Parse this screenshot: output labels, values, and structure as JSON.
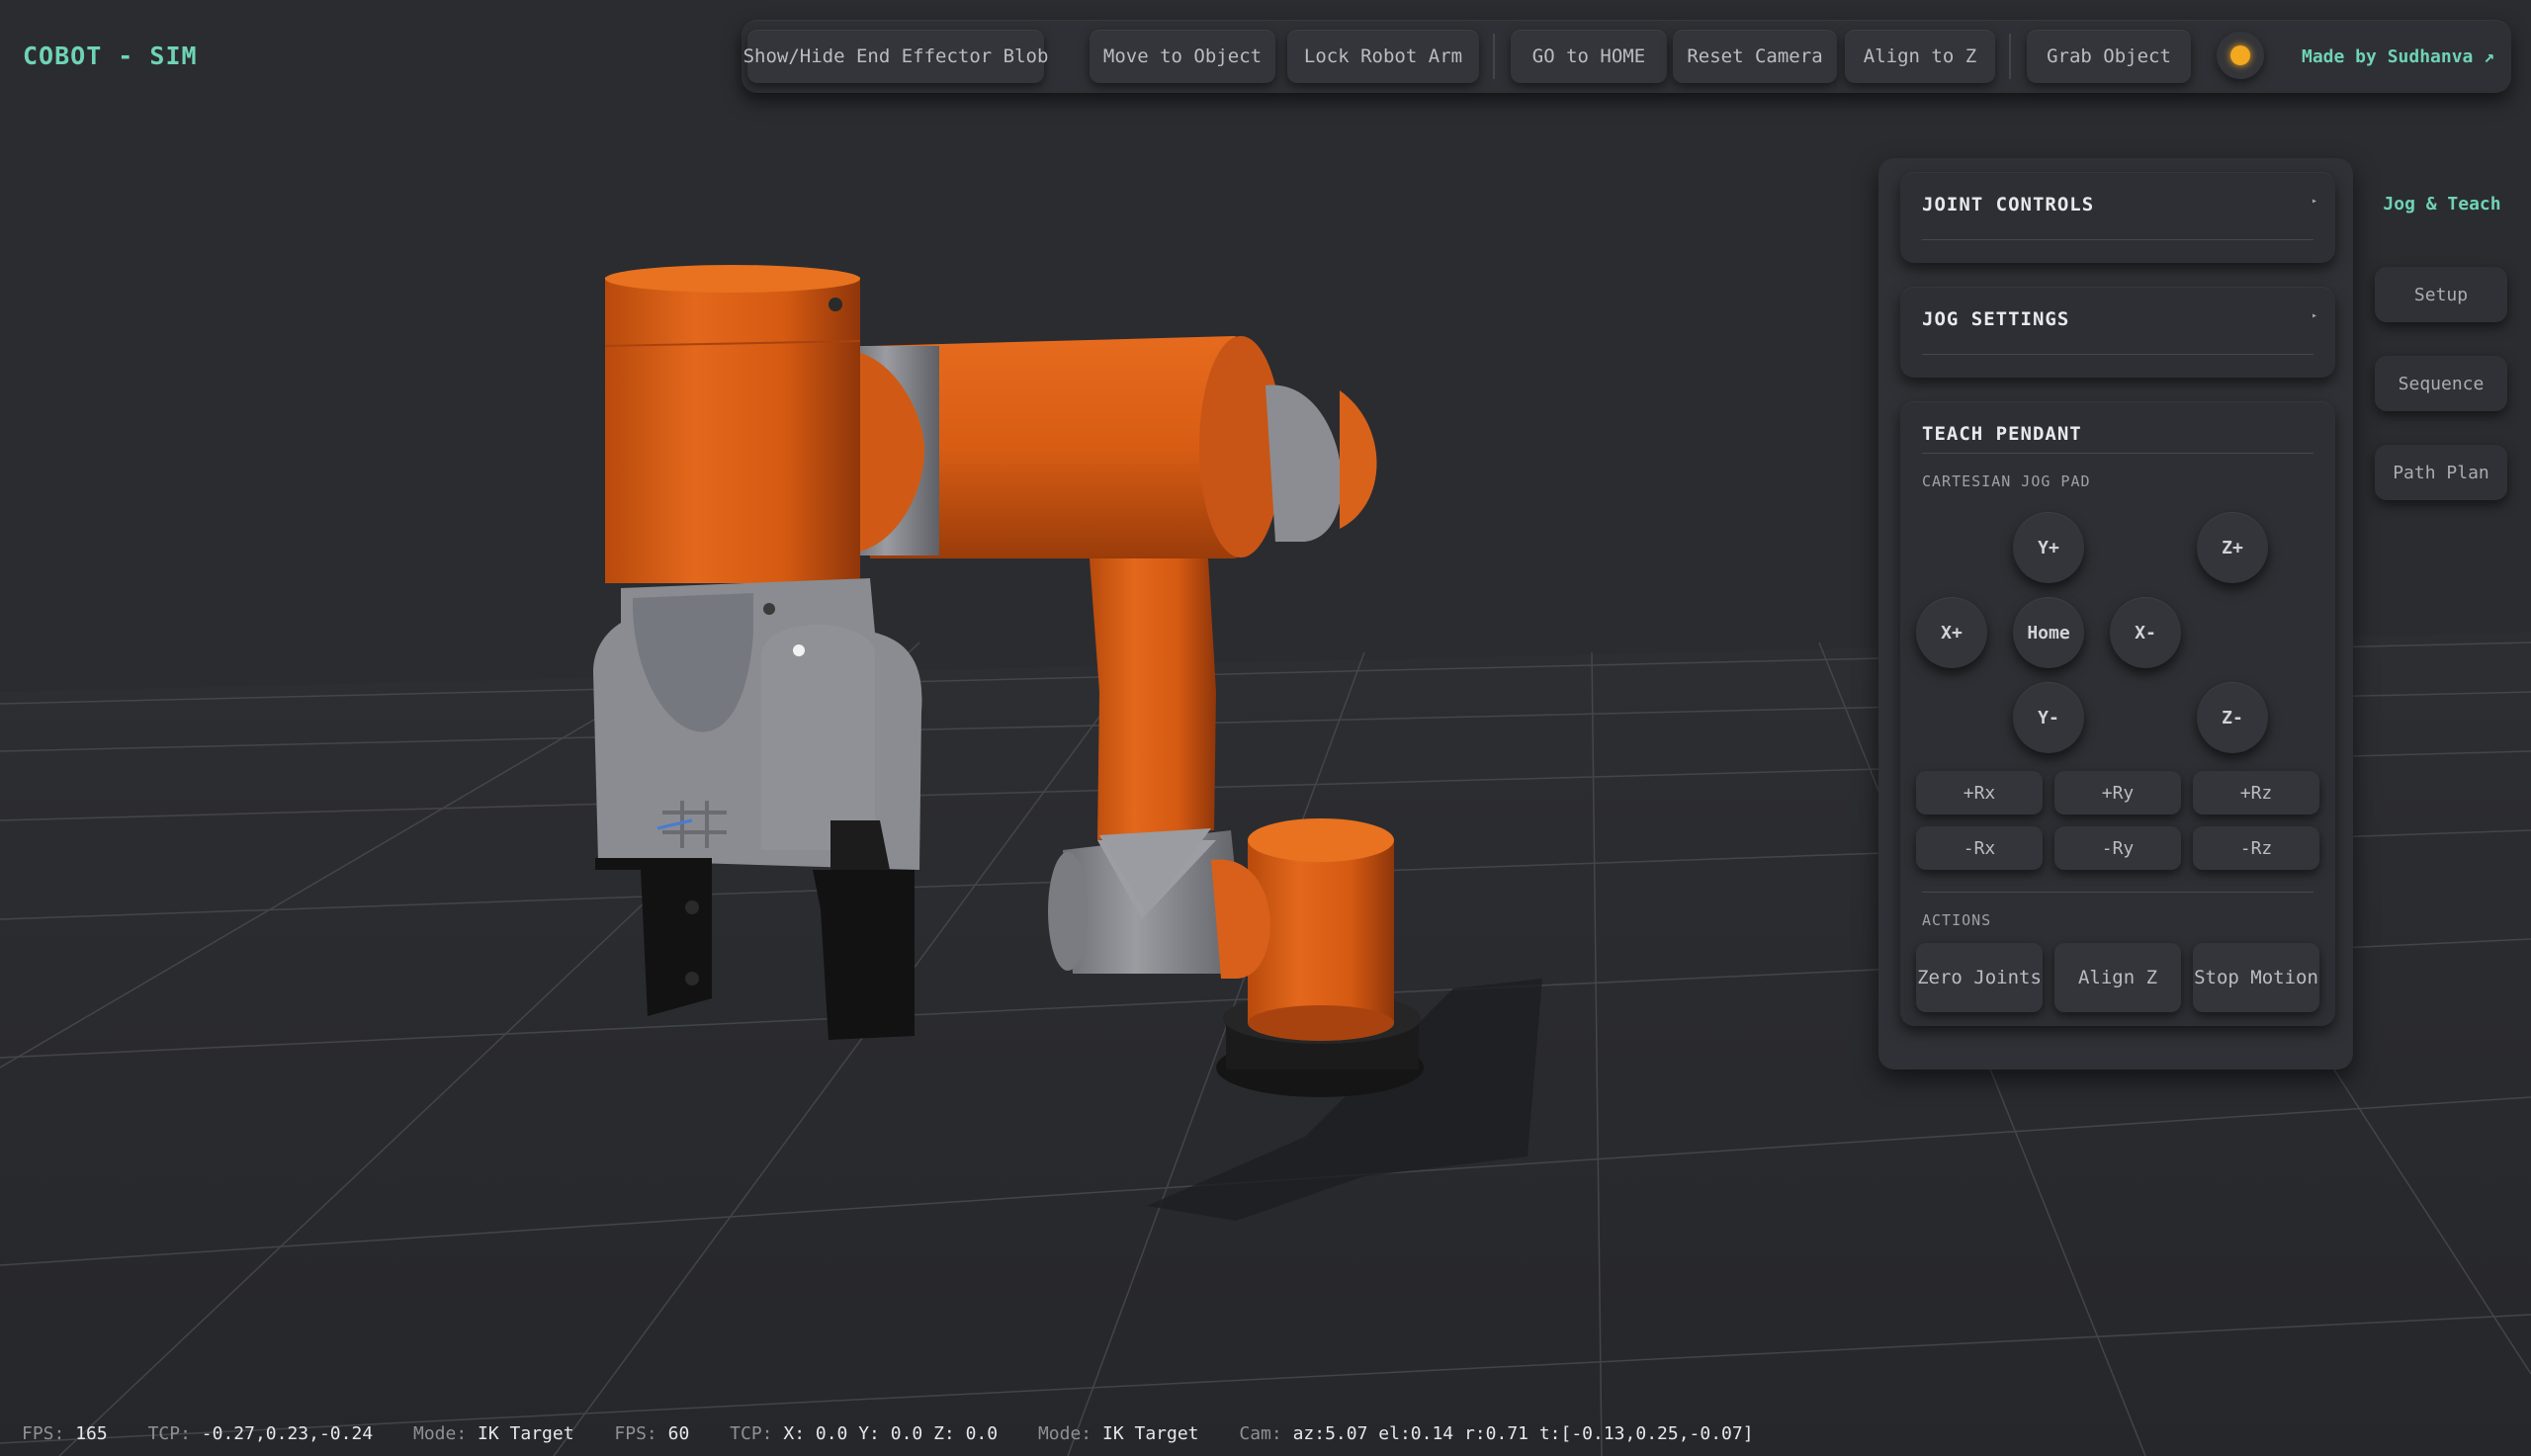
{
  "app": {
    "title": "COBOT - SIM"
  },
  "toolbar": {
    "buttons": [
      {
        "label": "Show/Hide End Effector Blob"
      },
      {
        "label": "Move to Object"
      },
      {
        "label": "Lock Robot Arm"
      },
      {
        "label": "GO to HOME"
      },
      {
        "label": "Reset Camera"
      },
      {
        "label": "Align to Z"
      },
      {
        "label": "Grab Object"
      }
    ],
    "theme_icon": "sun-icon",
    "made_by": "Made by Sudhanva ↗"
  },
  "panel": {
    "joint_controls": {
      "title": "JOINT CONTROLS",
      "caret": "▸"
    },
    "jog_settings": {
      "title": "JOG SETTINGS",
      "caret": "▸"
    },
    "teach_pendant": {
      "title": "TEACH PENDANT",
      "jog_pad_label": "CARTESIAN JOG PAD",
      "jog": {
        "y_plus": "Y+",
        "z_plus": "Z+",
        "x_plus": "X+",
        "home": "Home",
        "x_minus": "X-",
        "y_minus": "Y-",
        "z_minus": "Z-"
      },
      "rotation": {
        "rx_plus": "+Rx",
        "ry_plus": "+Ry",
        "rz_plus": "+Rz",
        "rx_minus": "-Rx",
        "ry_minus": "-Ry",
        "rz_minus": "-Rz"
      },
      "actions_label": "ACTIONS",
      "actions": {
        "zero_joints": "Zero Joints",
        "align_z": "Align Z",
        "stop_motion": "Stop Motion"
      }
    }
  },
  "side_tabs": {
    "active": "Jog & Teach",
    "items": [
      {
        "label": "Setup"
      },
      {
        "label": "Sequence"
      },
      {
        "label": "Path Plan"
      }
    ]
  },
  "status": {
    "fps1_k": "FPS:",
    "fps1_v": "165",
    "tcp1_k": "TCP:",
    "tcp1_v": "-0.27,0.23,-0.24",
    "mode1_k": "Mode:",
    "mode1_v": "IK Target",
    "fps2_k": "FPS:",
    "fps2_v": "60",
    "tcp2_k": "TCP:",
    "tcp2_v": "X: 0.0 Y: 0.0 Z: 0.0",
    "mode2_k": "Mode:",
    "mode2_v": "IK Target",
    "cam_k": "Cam:",
    "cam_v": "az:5.07 el:0.14 r:0.71 t:[-0.13,0.25,-0.07]"
  },
  "colors": {
    "accent": "#6fd3b6",
    "robot_orange": "#e0661a",
    "robot_grey": "#8e9096",
    "background": "#2b2c30"
  }
}
